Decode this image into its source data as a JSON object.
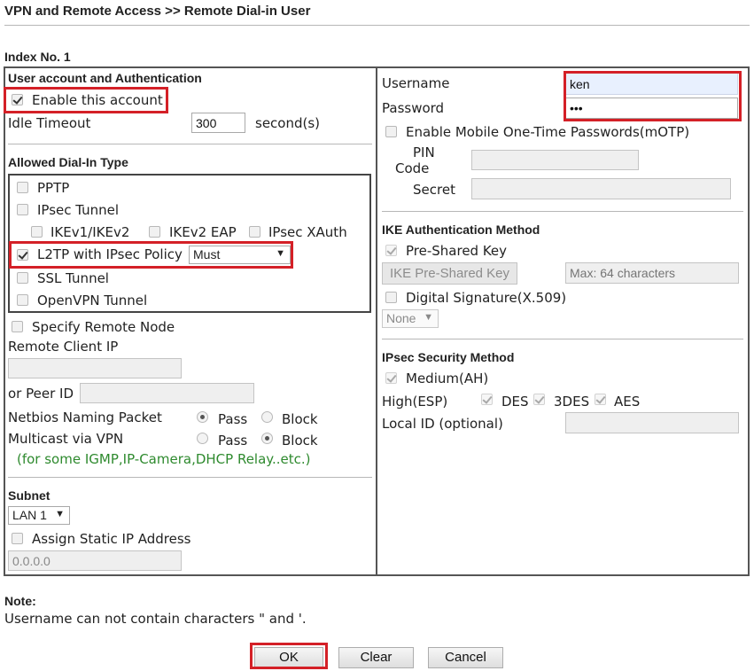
{
  "header": {
    "title": "VPN and Remote Access >> Remote Dial-in User"
  },
  "index_label": "Index No. 1",
  "left": {
    "auth_title": "User account and Authentication",
    "enable_account": {
      "label": "Enable this account",
      "checked": true
    },
    "idle_timeout": {
      "label": "Idle Timeout",
      "value": "300",
      "unit": "second(s)"
    },
    "dialin_title": "Allowed Dial-In Type",
    "pptp": "PPTP",
    "ipsec_tunnel": "IPsec Tunnel",
    "ikev1": "IKEv1/IKEv2",
    "ikev2eap": "IKEv2 EAP",
    "ipsec_xauth": "IPsec XAuth",
    "l2tp": {
      "label": "L2TP with IPsec Policy",
      "checked": true,
      "policy": "Must"
    },
    "ssl_tunnel": "SSL Tunnel",
    "openvpn": "OpenVPN Tunnel",
    "specify_remote": "Specify Remote Node",
    "remote_client_ip": "Remote Client IP",
    "or_peer_id": "or Peer ID",
    "netbios": {
      "label": "Netbios Naming Packet",
      "pass": "Pass",
      "block": "Block",
      "selected": "Pass"
    },
    "multicast": {
      "label": "Multicast via VPN",
      "pass": "Pass",
      "block": "Block",
      "selected": "Block"
    },
    "multicast_note": "(for some IGMP,IP-Camera,DHCP Relay..etc.)",
    "subnet_title": "Subnet",
    "subnet_select": "LAN 1",
    "assign_static": "Assign Static IP Address",
    "static_ip": "0.0.0.0"
  },
  "right": {
    "username_label": "Username",
    "username_value": "ken",
    "password_label": "Password",
    "password_value": "•••",
    "motp": "Enable Mobile One-Time Passwords(mOTP)",
    "pin_line1": "PIN",
    "pin_line2": "Code",
    "secret": "Secret",
    "ike_title": "IKE Authentication Method",
    "preshared": "Pre-Shared Key",
    "ike_psk_button": "IKE Pre-Shared Key",
    "ike_psk_placeholder": "Max: 64 characters",
    "digital_sig": "Digital Signature(X.509)",
    "digital_sig_select": "None",
    "ipsec_title": "IPsec Security Method",
    "medium_ah": "Medium(AH)",
    "high_esp": "High(ESP)",
    "des": "DES",
    "des3": "3DES",
    "aes": "AES",
    "local_id": "Local ID (optional)"
  },
  "note": {
    "title": "Note:",
    "text": "Username can not contain characters \" and '."
  },
  "buttons": {
    "ok": "OK",
    "clear": "Clear",
    "cancel": "Cancel"
  },
  "colors": {
    "highlight": "#d42027",
    "hint": "#2e8a2e"
  }
}
